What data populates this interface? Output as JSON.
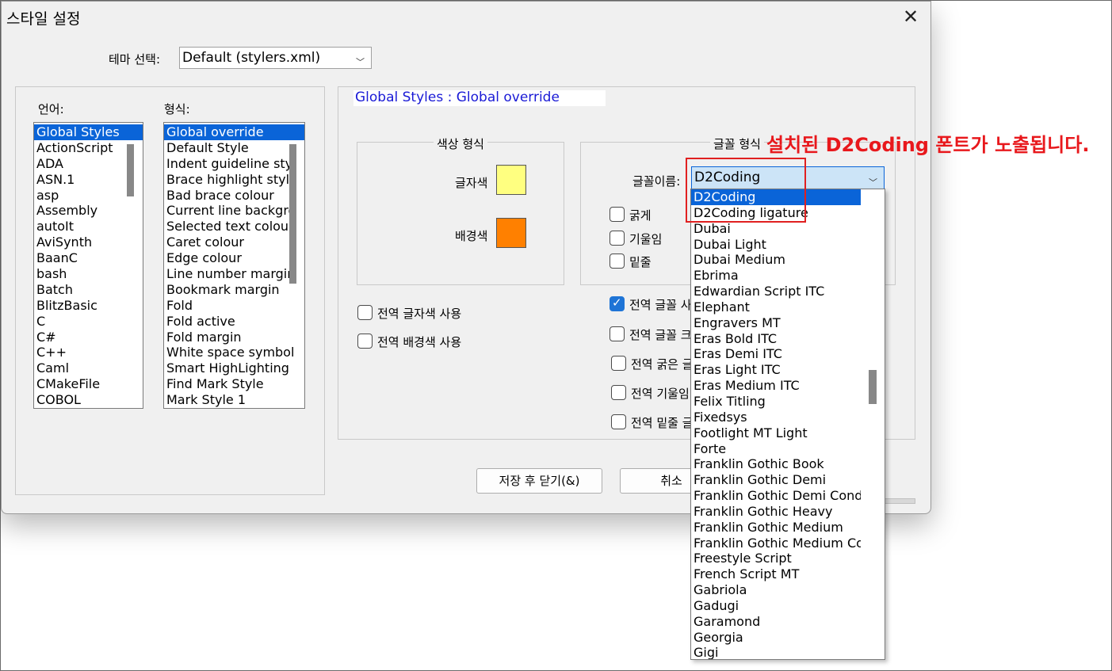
{
  "dialog": {
    "title": "스타일 설정",
    "theme_label": "테마 선택:",
    "theme_value": "Default (stylers.xml)"
  },
  "language": {
    "label": "언어:",
    "items": [
      "Global Styles",
      "ActionScript",
      "ADA",
      "ASN.1",
      "asp",
      "Assembly",
      "autoIt",
      "AviSynth",
      "BaanC",
      "bash",
      "Batch",
      "BlitzBasic",
      "C",
      "C#",
      "C++",
      "Caml",
      "CMakeFile",
      "COBOL"
    ],
    "selected_index": 0
  },
  "style": {
    "label": "형식:",
    "items": [
      "Global override",
      "Default Style",
      "Indent guideline sty",
      "Brace highlight style",
      "Bad brace colour",
      "Current line backgro",
      "Selected text colour",
      "Caret colour",
      "Edge colour",
      "Line number margin",
      "Bookmark margin",
      "Fold",
      "Fold active",
      "Fold margin",
      "White space symbol",
      "Smart HighLighting",
      "Find Mark Style",
      "Mark Style 1"
    ],
    "selected_index": 0
  },
  "heading": "Global Styles : Global override",
  "colour_group": {
    "title": "색상 형식",
    "fg_label": "글자색",
    "bg_label": "배경색",
    "fg_color": "#ffff80",
    "bg_color": "#ff8000"
  },
  "font_group": {
    "title": "글꼴 형식",
    "name_label": "글꼴이름:",
    "name_value": "D2Coding",
    "bold": "굵게",
    "italic": "기울임",
    "underline": "밑줄"
  },
  "global_checks": {
    "fg": "전역 글자색 사용",
    "bg": "전역 배경색 사용",
    "font": "전역 글꼴 사",
    "size": "전역 글꼴 크",
    "bold": "전역 굵은 글",
    "italic": "전역 기울임",
    "underline": "전역 밑줄 글"
  },
  "buttons": {
    "save_close": "저장 후 닫기(&)",
    "cancel": "취소"
  },
  "font_dropdown": {
    "items": [
      "D2Coding",
      "D2Coding ligature",
      "Dubai",
      "Dubai Light",
      "Dubai Medium",
      "Ebrima",
      "Edwardian Script ITC",
      "Elephant",
      "Engravers MT",
      "Eras Bold ITC",
      "Eras Demi ITC",
      "Eras Light ITC",
      "Eras Medium ITC",
      "Felix Titling",
      "Fixedsys",
      "Footlight MT Light",
      "Forte",
      "Franklin Gothic Book",
      "Franklin Gothic Demi",
      "Franklin Gothic Demi Cond",
      "Franklin Gothic Heavy",
      "Franklin Gothic Medium",
      "Franklin Gothic Medium Cond",
      "Freestyle Script",
      "French Script MT",
      "Gabriola",
      "Gadugi",
      "Garamond",
      "Georgia",
      "Gigi"
    ],
    "selected_index": 0
  },
  "annotation": "설치된 D2Coding 폰트가 노출됩니다.",
  "colors": {
    "accent": "#0a64d8",
    "annotation": "#e8181c"
  }
}
